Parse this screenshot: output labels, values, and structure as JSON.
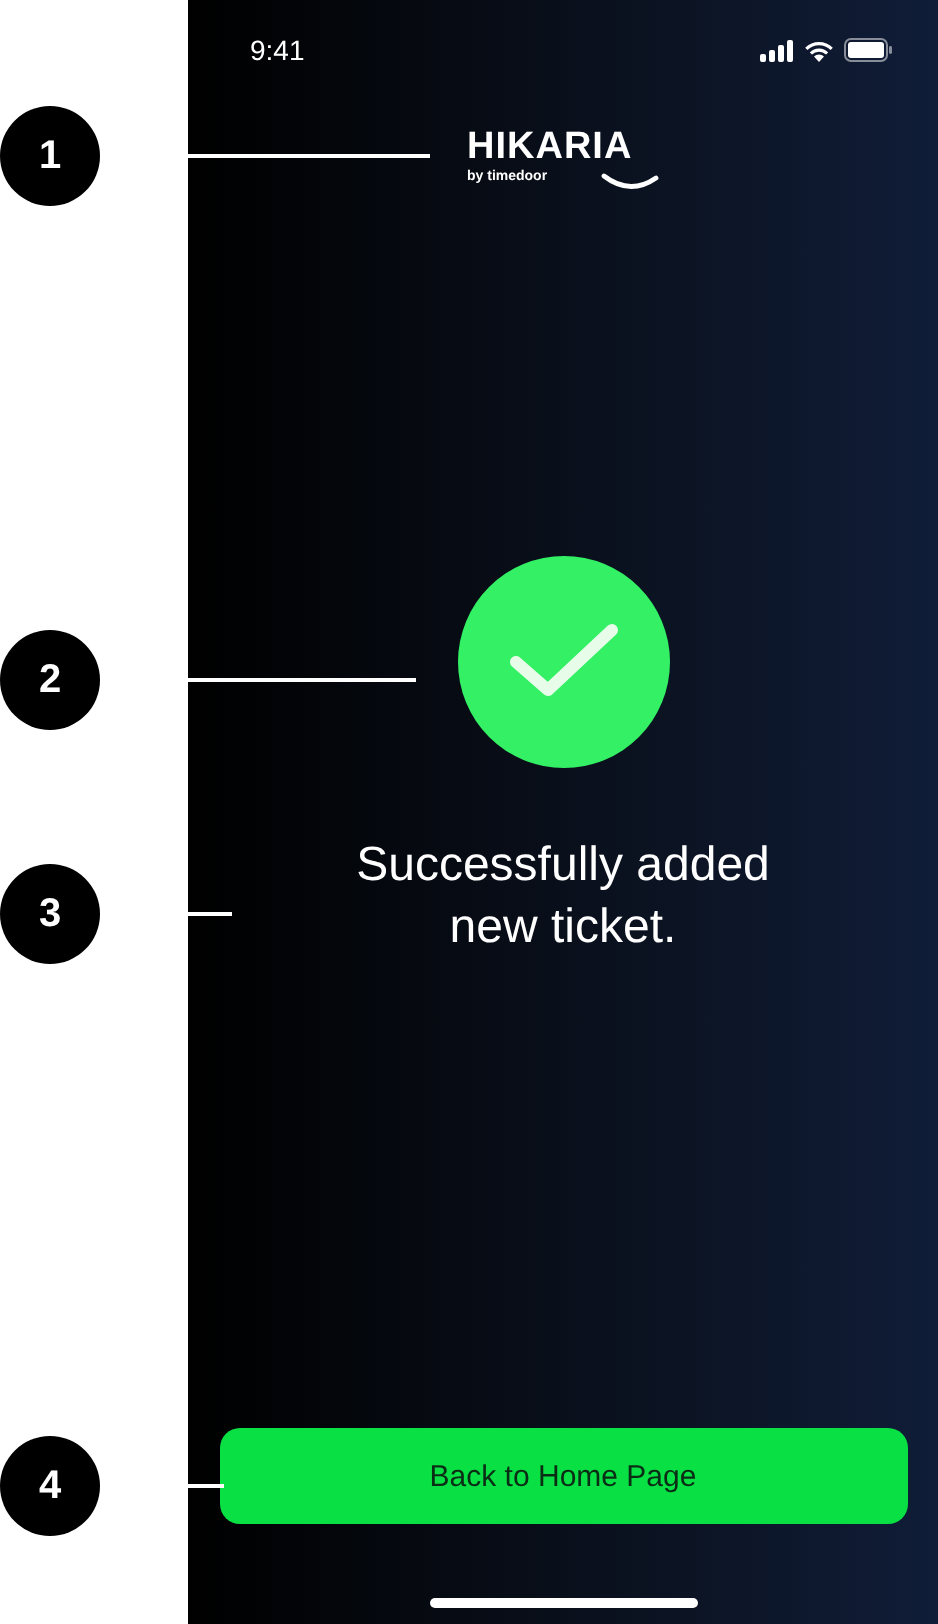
{
  "status_bar": {
    "time": "9:41"
  },
  "logo": {
    "name": "HIKARIA",
    "tagline": "by timedoor"
  },
  "message": "Successfully added new ticket.",
  "button": {
    "label": "Back to Home Page"
  },
  "callouts": [
    {
      "number": "1"
    },
    {
      "number": "2"
    },
    {
      "number": "3"
    },
    {
      "number": "4"
    }
  ]
}
